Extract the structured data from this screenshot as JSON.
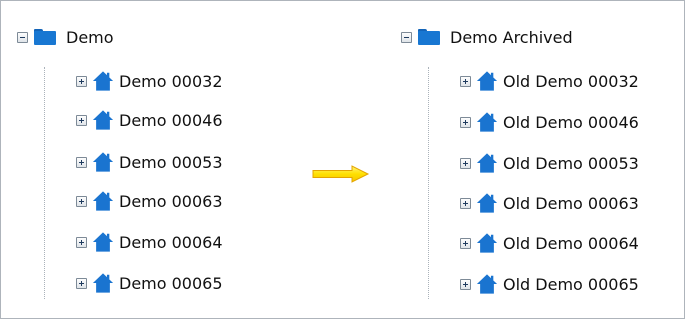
{
  "left_tree": {
    "root_label": "Demo",
    "items": [
      "Demo 00032",
      "Demo 00046",
      "Demo 00053",
      "Demo 00063",
      "Demo 00064",
      "Demo 00065"
    ]
  },
  "right_tree": {
    "root_label": "Demo Archived",
    "items": [
      "Old Demo 00032",
      "Old Demo 00046",
      "Old Demo 00053",
      "Old Demo 00063",
      "Old Demo 00064",
      "Old Demo 00065"
    ]
  },
  "colors": {
    "folder": "#1877d2",
    "house": "#1a74d0",
    "arrow_fill": "#ffe000",
    "arrow_stroke": "#e3a400"
  },
  "icons": {
    "root_toggle": "minus-box-icon",
    "item_toggle": "plus-box-icon",
    "root_icon": "folder-icon",
    "item_icon": "house-icon",
    "transition": "arrow-right-icon"
  }
}
